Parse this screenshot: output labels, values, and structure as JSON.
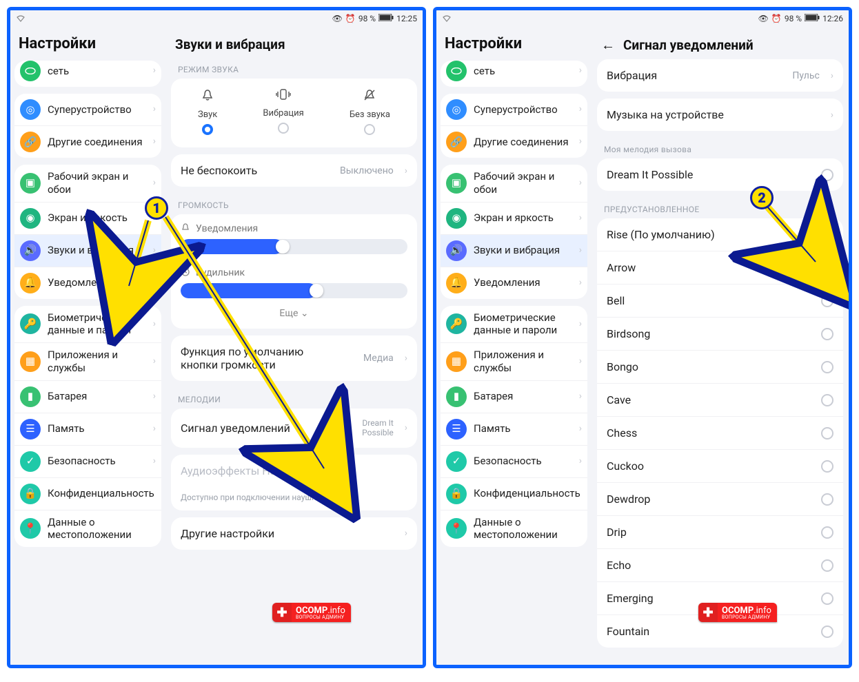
{
  "status": {
    "battery": "98 %",
    "time1": "12:25",
    "time2": "12:26"
  },
  "sidebar_title": "Настройки",
  "sidebar": {
    "g0": [
      "сеть"
    ],
    "g1": [
      "Суперустройство",
      "Другие соединения"
    ],
    "g2": [
      "Рабочий экран и обои",
      "Экран и яркость",
      "Звуки и вибрация",
      "Уведомления"
    ],
    "g3": [
      "Биометрические данные и пароли",
      "Приложения и службы",
      "Батарея",
      "Память",
      "Безопасность",
      "Конфиденциальность",
      "Данные о местоположении"
    ]
  },
  "left": {
    "title": "Звуки и вибрация",
    "mode_label": "РЕЖИМ ЗВУКА",
    "modes": [
      "Звук",
      "Вибрация",
      "Без звука"
    ],
    "dnd": "Не беспокоить",
    "dnd_val": "Выключено",
    "vol_label": "ГРОМКОСТЬ",
    "vol_notif": "Уведомления",
    "vol_alarm": "Будильник",
    "more": "Еще",
    "func": "Функция по умолчанию кнопки громкости",
    "func_val": "Медиа",
    "melody_label": "МЕЛОДИИ",
    "sig": "Сигнал уведомлений",
    "sig_val": "Dream It Possible",
    "histen": "Аудиоэффекты Huawei Histen",
    "histen_hint": "Доступно при подключении наушников",
    "other": "Другие настройки"
  },
  "right": {
    "title": "Сигнал уведомлений",
    "vib": "Вибрация",
    "vib_val": "Пульс",
    "music": "Музыка на устройстве",
    "myring": "Моя мелодия вызова",
    "myring_item": "Dream It Possible",
    "preset": "ПРЕДУСТАНОВЛЕННОЕ",
    "presets": [
      "Rise (По умолчанию)",
      "Arrow",
      "Bell",
      "Birdsong",
      "Bongo",
      "Cave",
      "Chess",
      "Cuckoo",
      "Dewdrop",
      "Drip",
      "Echo",
      "Emerging",
      "Fountain"
    ]
  },
  "watermark": {
    "brand": "OCOMP",
    "tld": ".info",
    "sub": "ВОПРОСЫ АДМИНУ"
  },
  "markers": {
    "m1": "1",
    "m2": "2"
  }
}
